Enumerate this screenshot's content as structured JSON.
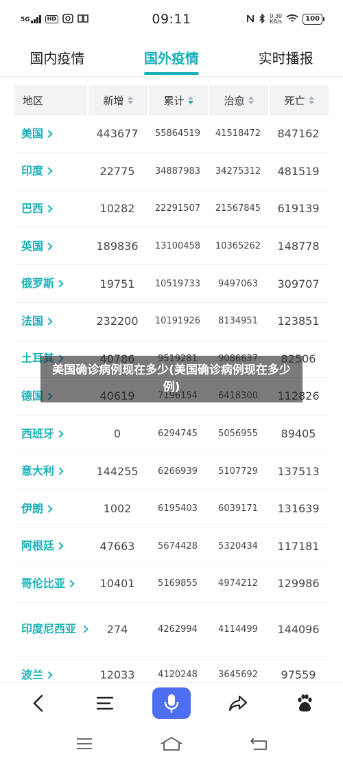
{
  "status_bar": {
    "signal": "5G",
    "hd": "HD",
    "time": "09:11",
    "speed_value": "0.30",
    "speed_unit": "KB/s",
    "battery": "100"
  },
  "tabs": [
    {
      "label": "国内疫情",
      "active": false
    },
    {
      "label": "国外疫情",
      "active": true
    },
    {
      "label": "实时播报",
      "active": false
    }
  ],
  "table": {
    "headers": {
      "region": "地区",
      "new": "新增",
      "total": "累计",
      "cured": "治愈",
      "deaths": "死亡"
    },
    "sorted_column": "total",
    "rows": [
      {
        "region": "美国",
        "new": "443677",
        "total": "55864519",
        "cured": "41518472",
        "deaths": "847162"
      },
      {
        "region": "印度",
        "new": "22775",
        "total": "34887983",
        "cured": "34275312",
        "deaths": "481519"
      },
      {
        "region": "巴西",
        "new": "10282",
        "total": "22291507",
        "cured": "21567845",
        "deaths": "619139"
      },
      {
        "region": "英国",
        "new": "189836",
        "total": "13100458",
        "cured": "10365262",
        "deaths": "148778"
      },
      {
        "region": "俄罗斯",
        "new": "19751",
        "total": "10519733",
        "cured": "9497063",
        "deaths": "309707"
      },
      {
        "region": "法国",
        "new": "232200",
        "total": "10191926",
        "cured": "8134951",
        "deaths": "123851"
      },
      {
        "region": "土耳其",
        "new": "40786",
        "total": "9519281",
        "cured": "9086637",
        "deaths": "82506"
      },
      {
        "region": "德国",
        "new": "40619",
        "total": "7196154",
        "cured": "6418300",
        "deaths": "112826"
      },
      {
        "region": "西班牙",
        "new": "0",
        "total": "6294745",
        "cured": "5056955",
        "deaths": "89405"
      },
      {
        "region": "意大利",
        "new": "144255",
        "total": "6266939",
        "cured": "5107729",
        "deaths": "137513"
      },
      {
        "region": "伊朗",
        "new": "1002",
        "total": "6195403",
        "cured": "6039171",
        "deaths": "131639"
      },
      {
        "region": "阿根廷",
        "new": "47663",
        "total": "5674428",
        "cured": "5320434",
        "deaths": "117181"
      },
      {
        "region": "哥伦比亚",
        "new": "10401",
        "total": "5169855",
        "cured": "4974212",
        "deaths": "129986"
      },
      {
        "region": "印度尼西亚",
        "new": "274",
        "total": "4262994",
        "cured": "4114499",
        "deaths": "144096"
      },
      {
        "region": "波兰",
        "new": "12033",
        "total": "4120248",
        "cured": "3645692",
        "deaths": "97559"
      }
    ]
  },
  "caption": "美国确诊病例现在多少(美国确诊病例现在多少例)",
  "toolbar": [
    "back-icon",
    "menu-icon",
    "mic-icon",
    "share-icon",
    "baidu-icon"
  ],
  "navbar": [
    "recent-apps-icon",
    "home-icon",
    "back-nav-icon"
  ],
  "colors": {
    "accent": "#1ab1b8",
    "mic": "#4e6ef2"
  }
}
